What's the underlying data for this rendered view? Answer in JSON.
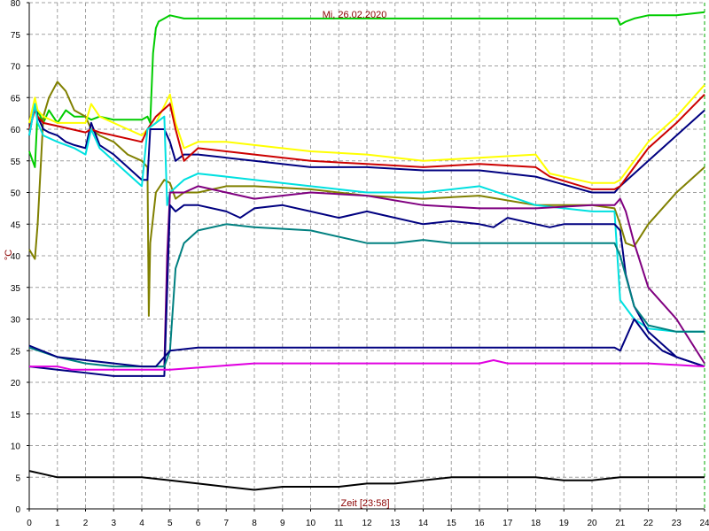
{
  "chart_data": {
    "type": "line",
    "title": "Mi, 26.02.2020",
    "xlabel": "Zeit [23:58]",
    "ylabel": "°C",
    "xlim": [
      0,
      24
    ],
    "ylim": [
      0,
      80
    ],
    "x_ticks": [
      "0",
      "1",
      "2",
      "3",
      "4",
      "5",
      "6",
      "7",
      "8",
      "9",
      "10",
      "11",
      "12",
      "13",
      "14",
      "15",
      "16",
      "17",
      "18",
      "19",
      "20",
      "21",
      "22",
      "23",
      "24"
    ],
    "y_ticks": [
      "0",
      "5",
      "10",
      "15",
      "20",
      "25",
      "30",
      "35",
      "40",
      "45",
      "50",
      "55",
      "60",
      "65",
      "70",
      "75",
      "80"
    ],
    "grid": true,
    "series": [
      {
        "color": "#00cc00",
        "x": [
          0,
          0.2,
          0.3,
          0.5,
          0.7,
          1,
          1.3,
          1.6,
          2,
          2.2,
          2.5,
          3,
          3.5,
          4,
          4.2,
          4.3,
          4.4,
          4.5,
          4.6,
          4.8,
          5,
          5.5,
          6,
          8,
          10,
          12,
          14,
          16,
          18,
          20,
          20.9,
          21,
          21.2,
          21.5,
          22,
          23,
          24
        ],
        "y": [
          56.5,
          54,
          63,
          61,
          63,
          61,
          63,
          62,
          62,
          61.5,
          62,
          61.5,
          61.5,
          61.5,
          62,
          61,
          72,
          76,
          77,
          77.5,
          78,
          77.5,
          77.5,
          77.5,
          77.5,
          77.5,
          77.5,
          77.5,
          77.5,
          77.5,
          77.5,
          76.5,
          77,
          77.5,
          78,
          78,
          78.5
        ]
      },
      {
        "color": "#808000",
        "x": [
          0,
          0.2,
          0.3,
          0.5,
          0.7,
          1,
          1.3,
          1.6,
          2,
          2.2,
          2.5,
          3,
          3.5,
          4,
          4.2,
          4.25,
          4.3,
          4.5,
          4.8,
          5,
          5.2,
          5.5,
          6,
          7,
          8,
          10,
          12,
          14,
          16,
          18,
          20,
          20.8,
          21,
          21.2,
          21.5,
          22,
          23,
          24
        ],
        "y": [
          41,
          39.5,
          45,
          62,
          65,
          67.5,
          66,
          63,
          62,
          60,
          59,
          58,
          56,
          55,
          54,
          30.5,
          42,
          50,
          52,
          51.5,
          49,
          50,
          50,
          51,
          51,
          50.5,
          49.5,
          49,
          49.5,
          48,
          48,
          47.5,
          45,
          42,
          41.5,
          45,
          50,
          54
        ]
      },
      {
        "color": "#000080",
        "x": [
          0,
          0.2,
          0.3,
          0.5,
          0.7,
          1,
          1.3,
          1.6,
          2,
          2.2,
          2.5,
          3,
          3.5,
          4,
          4.2,
          4.3,
          4.5,
          4.8,
          5,
          5.2,
          5.5,
          6,
          7,
          8,
          10,
          12,
          14,
          16,
          18,
          20,
          20.8,
          21,
          21.5,
          22,
          23,
          24
        ],
        "y": [
          59,
          64,
          62,
          60,
          59.5,
          59,
          58,
          57.5,
          57,
          61,
          57.5,
          56,
          54,
          52,
          52,
          60,
          60,
          60,
          58,
          55,
          56,
          56,
          55.5,
          55,
          54,
          54,
          53.5,
          53.5,
          52.5,
          50,
          50,
          51,
          53,
          55,
          59,
          63
        ]
      },
      {
        "color": "#ffff00",
        "x": [
          0,
          0.2,
          0.3,
          0.5,
          1,
          2,
          2.2,
          2.5,
          3,
          3.5,
          4,
          4.2,
          4.5,
          5,
          5.2,
          5.5,
          6,
          7,
          8,
          10,
          12,
          14,
          16,
          18,
          18.5,
          20,
          20.8,
          21,
          21.5,
          22,
          23,
          24
        ],
        "y": [
          61,
          65,
          63,
          62,
          61,
          61,
          64,
          62,
          61,
          60,
          59,
          60,
          61,
          65.5,
          61,
          57,
          58,
          58,
          57.5,
          56.5,
          56,
          55,
          55.5,
          56,
          53,
          51.5,
          51.5,
          52,
          55,
          58,
          62,
          67
        ]
      },
      {
        "color": "#cc0000",
        "x": [
          0,
          0.2,
          0.3,
          0.5,
          1,
          2,
          2.2,
          2.5,
          3,
          3.5,
          4,
          4.2,
          4.5,
          5,
          5.2,
          5.5,
          6,
          7,
          8,
          10,
          12,
          14,
          16,
          18,
          18.5,
          20,
          20.8,
          21,
          21.5,
          22,
          23,
          24
        ],
        "y": [
          60,
          63,
          62,
          61,
          60.5,
          59.5,
          60,
          59.5,
          59,
          58.5,
          58,
          60,
          62,
          64,
          60,
          55,
          57,
          56.5,
          56,
          55,
          54.5,
          54,
          54.5,
          54,
          52.5,
          50.5,
          50.5,
          51,
          54,
          57,
          61,
          65.5
        ]
      },
      {
        "color": "#00e0e0",
        "x": [
          0,
          0.2,
          0.3,
          0.5,
          1,
          1.6,
          2,
          2.2,
          2.5,
          3,
          3.5,
          4,
          4.2,
          4.5,
          4.8,
          4.9,
          5,
          5.5,
          6,
          7,
          8,
          10,
          12,
          14,
          16,
          18,
          20,
          20.8,
          21,
          21.5,
          22,
          23,
          24
        ],
        "y": [
          59,
          64,
          61,
          59,
          58,
          57,
          56,
          60,
          57,
          55,
          53,
          51,
          60,
          61,
          62,
          48,
          50,
          52,
          53,
          52.5,
          52,
          51,
          50,
          50,
          51,
          48,
          47,
          47,
          33,
          30,
          28.5,
          28,
          28
        ]
      },
      {
        "color": "#800080",
        "x": [
          4.8,
          4.9,
          5,
          5.5,
          6,
          7,
          8,
          10,
          12,
          14,
          16,
          18,
          20,
          20.8,
          21,
          21.2,
          21.5,
          22,
          23,
          24
        ],
        "y": [
          22.5,
          40,
          50,
          50,
          51,
          50,
          49,
          50,
          49.5,
          48,
          47.5,
          47.5,
          48,
          48,
          49,
          47,
          42,
          35,
          30,
          23
        ]
      },
      {
        "color": "#000080",
        "x": [
          0,
          1,
          2,
          3,
          4,
          4.8,
          5,
          5.2,
          5.5,
          6,
          7,
          7.5,
          8,
          9,
          10,
          11,
          12,
          13,
          14,
          15,
          16,
          16.5,
          17,
          18,
          18.5,
          19,
          20,
          20.8,
          21,
          21.2,
          21.5,
          22,
          23,
          24
        ],
        "y": [
          22.5,
          22,
          21.5,
          21,
          21,
          21,
          48,
          47,
          48,
          48,
          47,
          46,
          47.5,
          48,
          47,
          46,
          47,
          46,
          45,
          45.5,
          45,
          44.5,
          46,
          45,
          44.5,
          45,
          45,
          45,
          44,
          37,
          32,
          28,
          24,
          22.5
        ]
      },
      {
        "color": "#008080",
        "x": [
          0,
          1,
          2,
          3,
          4,
          4.8,
          5,
          5.2,
          5.5,
          6,
          7,
          8,
          10,
          12,
          13,
          14,
          15,
          16,
          17,
          18,
          19,
          20,
          20.8,
          21,
          21.5,
          22,
          23,
          24
        ],
        "y": [
          25.5,
          24,
          23,
          22.5,
          22.5,
          22.5,
          25,
          38,
          42,
          44,
          45,
          44.5,
          44,
          42,
          42,
          42.5,
          42,
          42,
          42,
          42,
          42,
          42,
          42,
          40,
          32,
          29,
          28,
          28
        ]
      },
      {
        "color": "#000080",
        "x": [
          0,
          1,
          2,
          3,
          4,
          4.5,
          4.8,
          5,
          6,
          8,
          10,
          12,
          14,
          16,
          18,
          20,
          20.8,
          21,
          21.5,
          22,
          22.5,
          23,
          24
        ],
        "y": [
          25.8,
          24,
          23.5,
          23,
          22.5,
          22.5,
          24,
          25,
          25.5,
          25.5,
          25.5,
          25.5,
          25.5,
          25.5,
          25.5,
          25.5,
          25.5,
          25,
          30,
          27,
          25,
          24,
          22.5
        ]
      },
      {
        "color": "#e000e0",
        "x": [
          0,
          1,
          1.5,
          2,
          4,
          5,
          8,
          10,
          12,
          14,
          16,
          16.5,
          17,
          17.5,
          18,
          20,
          22,
          24
        ],
        "y": [
          22.5,
          22.5,
          22,
          22,
          22,
          22,
          23,
          23,
          23,
          23,
          23,
          23.5,
          23,
          23,
          23,
          23,
          23,
          22.5
        ]
      },
      {
        "color": "#000000",
        "x": [
          0,
          0.5,
          1,
          2,
          3,
          4,
          5,
          6,
          7,
          8,
          9,
          10,
          11,
          12,
          13,
          14,
          15,
          16,
          17,
          18,
          19,
          20,
          21,
          22,
          23,
          24
        ],
        "y": [
          6,
          5.5,
          5,
          5,
          5,
          5,
          4.5,
          4,
          3.5,
          3,
          3.5,
          3.5,
          3.5,
          4,
          4,
          4.5,
          5,
          5,
          5,
          5,
          4.5,
          4.5,
          5,
          5,
          5,
          5
        ]
      }
    ]
  }
}
